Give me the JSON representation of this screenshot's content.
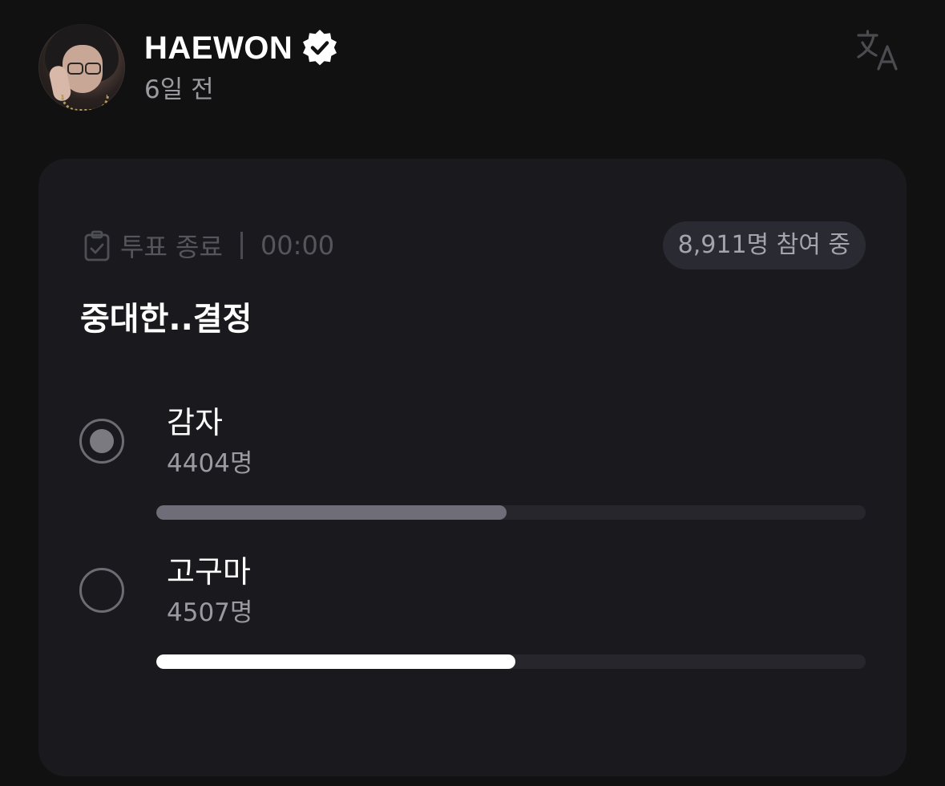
{
  "post": {
    "author": "HAEWON",
    "time_ago": "6일 전",
    "icons": {
      "verified": "verified-badge-icon",
      "translate": "translate-icon"
    }
  },
  "poll": {
    "status_label": "투표 종료",
    "timer": "00:00",
    "participants": "8,911명 참여 중",
    "title": "중대한..결정",
    "total_votes": 8911,
    "options": [
      {
        "label": "감자",
        "count": "4404명",
        "votes": 4404,
        "selected": true
      },
      {
        "label": "고구마",
        "count": "4507명",
        "votes": 4507,
        "selected": false
      }
    ]
  },
  "colors": {
    "background": "#111112",
    "card": "#1a1a1e",
    "selected_bar": "#6e6d78",
    "leading_bar": "#ffffff"
  }
}
